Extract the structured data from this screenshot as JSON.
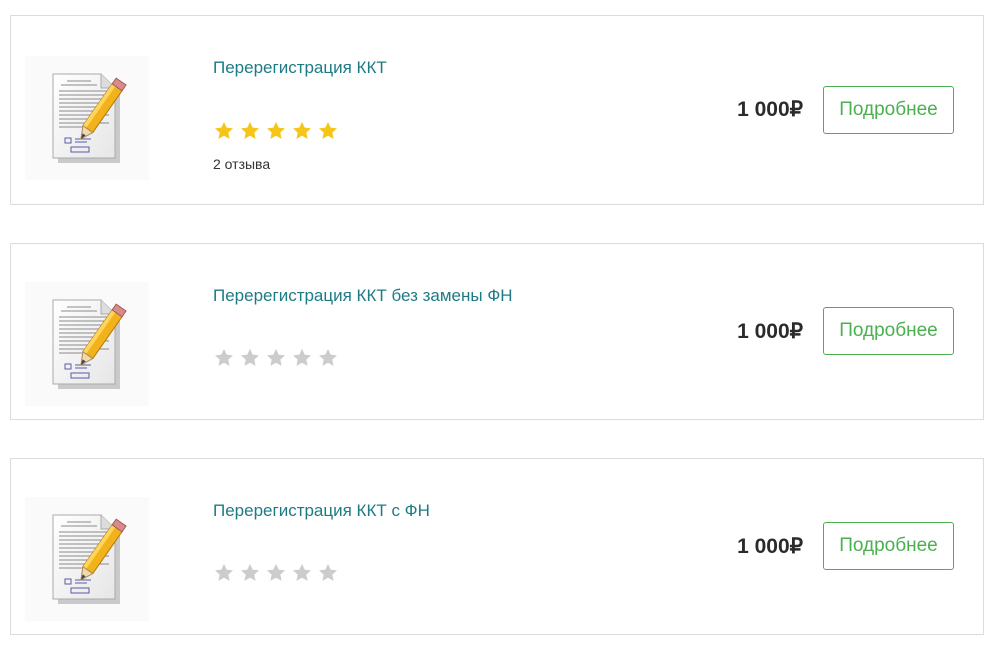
{
  "products": [
    {
      "title": "Перерегистрация ККТ",
      "rating_stars": 5,
      "rating_max": 5,
      "reviews": "2 отзыва",
      "price": "1 000₽",
      "button_label": "Подробнее",
      "thumbnail_icon": "document-pencil-icon"
    },
    {
      "title": "Перерегистрация ККТ без замены ФН",
      "rating_stars": 0,
      "rating_max": 5,
      "price": "1 000₽",
      "button_label": "Подробнее",
      "thumbnail_icon": "document-pencil-icon"
    },
    {
      "title": "Перерегистрация ККТ с ФН",
      "rating_stars": 0,
      "rating_max": 5,
      "price": "1 000₽",
      "button_label": "Подробнее",
      "thumbnail_icon": "document-pencil-icon"
    }
  ],
  "colors": {
    "title_link": "#1e7b85",
    "button_accent": "#4caf50",
    "star_filled": "#f5c518",
    "star_empty": "#cccccc",
    "border": "#dcdcdc"
  }
}
